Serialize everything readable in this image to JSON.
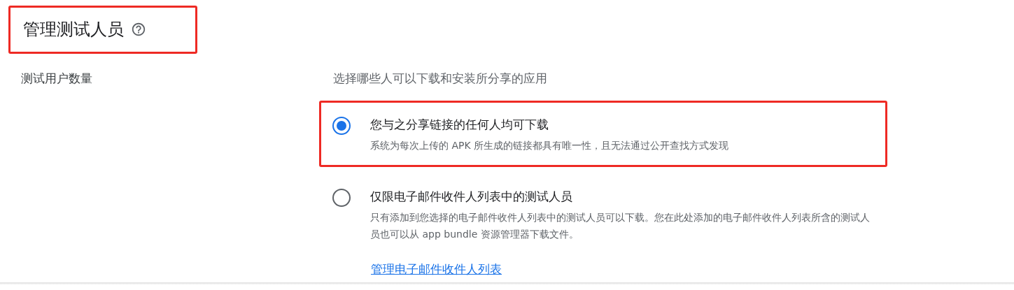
{
  "header": {
    "title": "管理测试人员",
    "highlighted": true
  },
  "section": {
    "label": "测试用户数量",
    "prompt": "选择哪些人可以下载和安装所分享的应用",
    "options": [
      {
        "title": "您与之分享链接的任何人均可下载",
        "description": "系统为每次上传的 APK 所生成的链接都具有唯一性，且无法通过公开查找方式发现",
        "selected": true,
        "highlighted": true
      },
      {
        "title": "仅限电子邮件收件人列表中的测试人员",
        "description": "只有添加到您选择的电子邮件收件人列表中的测试人员可以下载。您在此处添加的电子邮件收件人列表所含的测试人员也可以从 app bundle 资源管理器下载文件。",
        "selected": false,
        "highlighted": false
      }
    ],
    "link": "管理电子邮件收件人列表"
  }
}
